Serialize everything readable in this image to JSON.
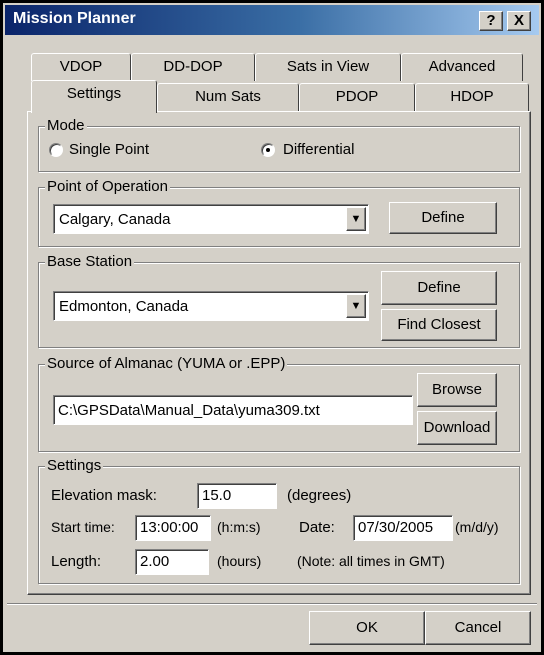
{
  "window": {
    "title": "Mission Planner",
    "help_button": "?",
    "close_button": "X"
  },
  "tabs": {
    "back_row": [
      "VDOP",
      "DD-DOP",
      "Sats in View",
      "Advanced"
    ],
    "front_row": [
      "Settings",
      "Num Sats",
      "PDOP",
      "HDOP"
    ],
    "active": "Settings"
  },
  "mode": {
    "label": "Mode",
    "options": [
      "Single Point",
      "Differential"
    ],
    "selected": "Differential"
  },
  "point_of_operation": {
    "label": "Point of Operation",
    "value": "Calgary, Canada",
    "define_label": "Define"
  },
  "base_station": {
    "label": "Base Station",
    "value": "Edmonton, Canada",
    "define_label": "Define",
    "find_closest_label": "Find Closest"
  },
  "almanac": {
    "label": "Source of Almanac (YUMA or .EPP)",
    "path": "C:\\GPSData\\Manual_Data\\yuma309.txt",
    "browse_label": "Browse",
    "download_label": "Download"
  },
  "settings": {
    "label": "Settings",
    "elevation_label": "Elevation mask:",
    "elevation_value": "15.0",
    "elevation_unit": "(degrees)",
    "start_label": "Start time:",
    "start_value": "13:00:00",
    "start_unit": "(h:m:s)",
    "date_label": "Date:",
    "date_value": "07/30/2005",
    "date_unit": "(m/d/y)",
    "length_label": "Length:",
    "length_value": "2.00",
    "length_unit": "(hours)",
    "note": "(Note: all times in GMT)"
  },
  "footer": {
    "ok_label": "OK",
    "cancel_label": "Cancel"
  },
  "icons": {
    "dropdown": "chevron-down-icon"
  }
}
